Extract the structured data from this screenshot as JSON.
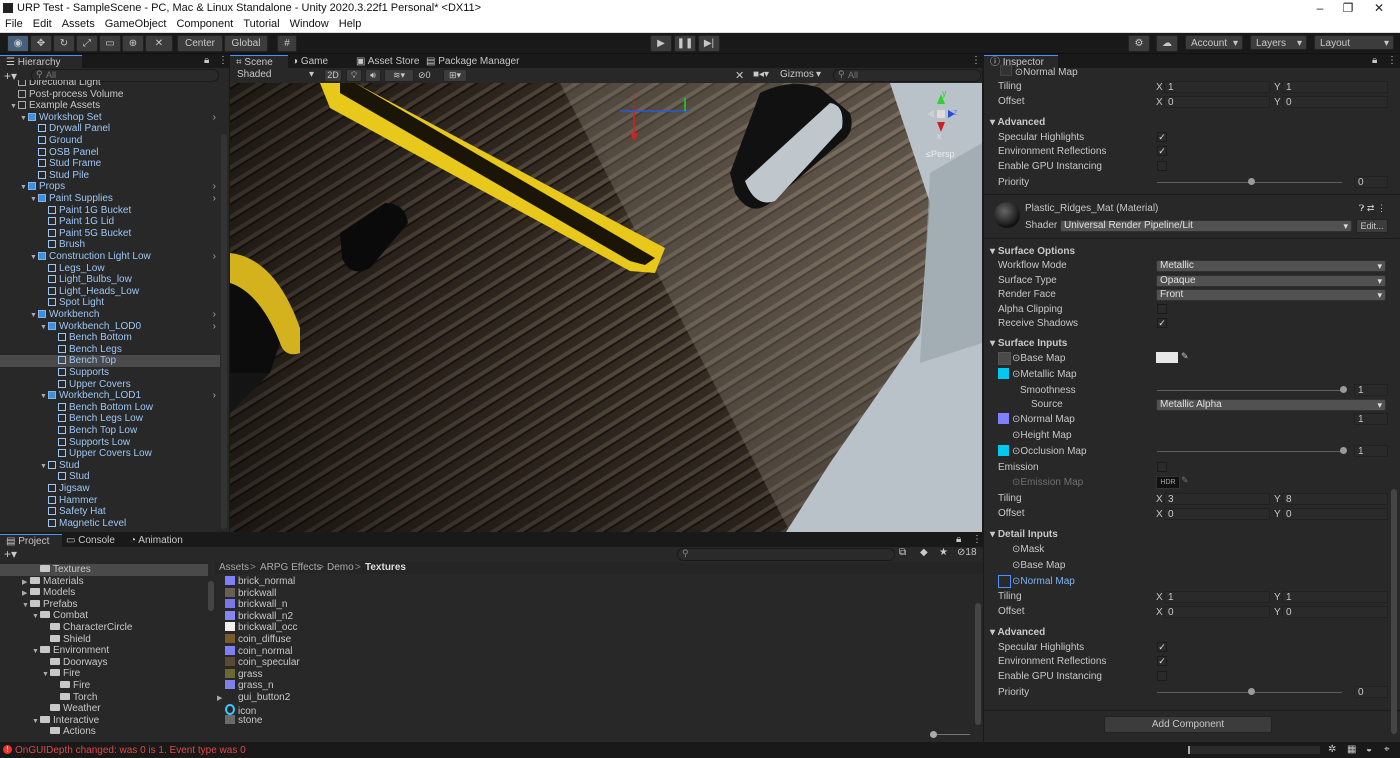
{
  "window": {
    "title": "URP Test - SampleScene - PC, Mac & Linux Standalone - Unity 2020.3.22f1 Personal* <DX11>"
  },
  "menu": [
    "File",
    "Edit",
    "Assets",
    "GameObject",
    "Component",
    "Tutorial",
    "Window",
    "Help"
  ],
  "toolbar": {
    "center": "Center",
    "global": "Global",
    "account": "Account",
    "layers": "Layers",
    "layout": "Layout"
  },
  "hierarchy": {
    "tab": "Hierarchy",
    "search_placeholder": "All",
    "items": [
      {
        "label": "Directional Light",
        "depth": 2,
        "arrow": false,
        "kind": "obj"
      },
      {
        "label": "Post-process Volume",
        "depth": 2,
        "arrow": false,
        "kind": "obj"
      },
      {
        "label": "Example Assets",
        "depth": 2,
        "arrow": true,
        "kind": "obj"
      },
      {
        "label": "Workshop Set",
        "depth": 3,
        "arrow": true,
        "kind": "prefab",
        "more": true
      },
      {
        "label": "Drywall Panel",
        "depth": 4,
        "arrow": false,
        "kind": "prefabchild"
      },
      {
        "label": "Ground",
        "depth": 4,
        "arrow": false,
        "kind": "prefabchild"
      },
      {
        "label": "OSB Panel",
        "depth": 4,
        "arrow": false,
        "kind": "prefabchild"
      },
      {
        "label": "Stud Frame",
        "depth": 4,
        "arrow": false,
        "kind": "prefabchild"
      },
      {
        "label": "Stud Pile",
        "depth": 4,
        "arrow": false,
        "kind": "prefabchild"
      },
      {
        "label": "Props",
        "depth": 3,
        "arrow": true,
        "kind": "prefab",
        "more": true
      },
      {
        "label": "Paint Supplies",
        "depth": 4,
        "arrow": true,
        "kind": "prefab",
        "more": true
      },
      {
        "label": "Paint 1G Bucket",
        "depth": 5,
        "arrow": false,
        "kind": "prefabchild"
      },
      {
        "label": "Paint 1G Lid",
        "depth": 5,
        "arrow": false,
        "kind": "prefabchild"
      },
      {
        "label": "Paint 5G Bucket",
        "depth": 5,
        "arrow": false,
        "kind": "prefabchild"
      },
      {
        "label": "Brush",
        "depth": 5,
        "arrow": false,
        "kind": "prefabchild"
      },
      {
        "label": "Construction Light Low",
        "depth": 4,
        "arrow": true,
        "kind": "prefab",
        "more": true
      },
      {
        "label": "Legs_Low",
        "depth": 5,
        "arrow": false,
        "kind": "prefabchild"
      },
      {
        "label": "Light_Bulbs_low",
        "depth": 5,
        "arrow": false,
        "kind": "prefabchild"
      },
      {
        "label": "Light_Heads_Low",
        "depth": 5,
        "arrow": false,
        "kind": "prefabchild"
      },
      {
        "label": "Spot Light",
        "depth": 5,
        "arrow": false,
        "kind": "prefabchild"
      },
      {
        "label": "Workbench",
        "depth": 4,
        "arrow": true,
        "kind": "prefab",
        "more": true
      },
      {
        "label": "Workbench_LOD0",
        "depth": 5,
        "arrow": true,
        "kind": "prefab",
        "more": true
      },
      {
        "label": "Bench Bottom",
        "depth": 6,
        "arrow": false,
        "kind": "prefabchild"
      },
      {
        "label": "Bench Legs",
        "depth": 6,
        "arrow": false,
        "kind": "prefabchild"
      },
      {
        "label": "Bench Top",
        "depth": 6,
        "arrow": false,
        "kind": "prefabchild",
        "selected": true
      },
      {
        "label": "Supports",
        "depth": 6,
        "arrow": false,
        "kind": "prefabchild"
      },
      {
        "label": "Upper Covers",
        "depth": 6,
        "arrow": false,
        "kind": "prefabchild"
      },
      {
        "label": "Workbench_LOD1",
        "depth": 5,
        "arrow": true,
        "kind": "prefab",
        "more": true
      },
      {
        "label": "Bench Bottom Low",
        "depth": 6,
        "arrow": false,
        "kind": "prefabchild"
      },
      {
        "label": "Bench Legs Low",
        "depth": 6,
        "arrow": false,
        "kind": "prefabchild"
      },
      {
        "label": "Bench Top Low",
        "depth": 6,
        "arrow": false,
        "kind": "prefabchild"
      },
      {
        "label": "Supports Low",
        "depth": 6,
        "arrow": false,
        "kind": "prefabchild"
      },
      {
        "label": "Upper Covers Low",
        "depth": 6,
        "arrow": false,
        "kind": "prefabchild"
      },
      {
        "label": "Stud",
        "depth": 5,
        "arrow": true,
        "kind": "prefabchild"
      },
      {
        "label": "Stud",
        "depth": 6,
        "arrow": false,
        "kind": "prefabchild"
      },
      {
        "label": "Jigsaw",
        "depth": 5,
        "arrow": false,
        "kind": "prefabchild"
      },
      {
        "label": "Hammer",
        "depth": 5,
        "arrow": false,
        "kind": "prefabchild"
      },
      {
        "label": "Safety Hat",
        "depth": 5,
        "arrow": false,
        "kind": "prefabchild"
      },
      {
        "label": "Magnetic Level",
        "depth": 5,
        "arrow": false,
        "kind": "prefabchild"
      }
    ]
  },
  "scene": {
    "tabs": [
      "Scene",
      "Game",
      "Asset Store",
      "Package Manager"
    ],
    "shading": "Shaded",
    "mode2d": "2D",
    "gizmos": "Gizmos",
    "search_placeholder": "All",
    "persp": "≤Persp",
    "fx_count": "0",
    "axis": {
      "x": "x",
      "y": "y",
      "z": "z"
    }
  },
  "project": {
    "tabs": [
      "Project",
      "Console",
      "Animation"
    ],
    "breadcrumb": [
      "Assets",
      "ARPG Effects",
      "Demo",
      "Textures"
    ],
    "hidden_count": "18",
    "tree": [
      {
        "label": "Textures",
        "depth": 3,
        "arrow": false,
        "selected": true
      },
      {
        "label": "Materials",
        "depth": 2,
        "arrow": true
      },
      {
        "label": "Models",
        "depth": 2,
        "arrow": true
      },
      {
        "label": "Prefabs",
        "depth": 2,
        "arrow": true,
        "open": true
      },
      {
        "label": "Combat",
        "depth": 3,
        "arrow": true,
        "open": true
      },
      {
        "label": "CharacterCircle",
        "depth": 4,
        "arrow": false
      },
      {
        "label": "Shield",
        "depth": 4,
        "arrow": false
      },
      {
        "label": "Environment",
        "depth": 3,
        "arrow": true,
        "open": true
      },
      {
        "label": "Doorways",
        "depth": 4,
        "arrow": false
      },
      {
        "label": "Fire",
        "depth": 4,
        "arrow": true,
        "open": true
      },
      {
        "label": "Fire",
        "depth": 5,
        "arrow": false
      },
      {
        "label": "Torch",
        "depth": 5,
        "arrow": false
      },
      {
        "label": "Weather",
        "depth": 4,
        "arrow": false
      },
      {
        "label": "Interactive",
        "depth": 3,
        "arrow": true,
        "open": true
      },
      {
        "label": "Actions",
        "depth": 4,
        "arrow": false
      }
    ],
    "assets": [
      {
        "label": "brick_normal",
        "color": "#8080ff"
      },
      {
        "label": "brickwall",
        "color": "#6a5f55"
      },
      {
        "label": "brickwall_n",
        "color": "#7a78e6"
      },
      {
        "label": "brickwall_n2",
        "color": "#8585f5"
      },
      {
        "label": "brickwall_occ",
        "color": "#f0f0f0"
      },
      {
        "label": "coin_diffuse",
        "color": "#7a5a2a"
      },
      {
        "label": "coin_normal",
        "color": "#7f7ff5"
      },
      {
        "label": "coin_specular",
        "color": "#5a4a35"
      },
      {
        "label": "grass",
        "color": "#6a6a30"
      },
      {
        "label": "grass_n",
        "color": "#8080e8"
      },
      {
        "label": "gui_button2",
        "color": "",
        "arrow": true
      },
      {
        "label": "icon",
        "color": "ring"
      },
      {
        "label": "stone",
        "color": "#6a6a6a"
      }
    ]
  },
  "inspector": {
    "tab": "Inspector",
    "top": {
      "normal_map": "Normal Map",
      "tiling": "Tiling",
      "tiling_x": "1",
      "tiling_y": "1",
      "offset": "Offset",
      "offset_x": "0",
      "offset_y": "0",
      "advanced": "Advanced",
      "specular": "Specular Highlights",
      "env_refl": "Environment Reflections",
      "gpu_inst": "Enable GPU Instancing",
      "priority": "Priority",
      "priority_val": "0"
    },
    "material": {
      "name": "Plastic_Ridges_Mat (Material)",
      "shader_label": "Shader",
      "shader": "Universal Render Pipeline/Lit",
      "edit": "Edit..."
    },
    "surface_options": {
      "header": "Surface Options",
      "workflow_label": "Workflow Mode",
      "workflow": "Metallic",
      "surface_label": "Surface Type",
      "surface": "Opaque",
      "render_face_label": "Render Face",
      "render_face": "Front",
      "alpha_clip": "Alpha Clipping",
      "receive_shadows": "Receive Shadows"
    },
    "surface_inputs": {
      "header": "Surface Inputs",
      "base_map": "Base Map",
      "metallic_map": "Metallic Map",
      "smoothness": "Smoothness",
      "smoothness_val": "1",
      "source_label": "Source",
      "source": "Metallic Alpha",
      "normal_map": "Normal Map",
      "normal_val": "1",
      "height_map": "Height Map",
      "occlusion_map": "Occlusion Map",
      "occlusion_val": "1",
      "emission": "Emission",
      "emission_map": "Emission Map",
      "hdr": "HDR",
      "tiling": "Tiling",
      "tiling_x": "3",
      "tiling_y": "8",
      "offset": "Offset",
      "offset_x": "0",
      "offset_y": "0"
    },
    "detail_inputs": {
      "header": "Detail Inputs",
      "mask": "Mask",
      "base_map": "Base Map",
      "normal_map": "Normal Map",
      "tiling": "Tiling",
      "tiling_x": "1",
      "tiling_y": "1",
      "offset": "Offset",
      "offset_x": "0",
      "offset_y": "0"
    },
    "advanced2": {
      "header": "Advanced",
      "specular": "Specular Highlights",
      "env_refl": "Environment Reflections",
      "gpu_inst": "Enable GPU Instancing",
      "priority": "Priority",
      "priority_val": "0"
    },
    "add_component": "Add Component",
    "x": "X",
    "y": "Y"
  },
  "status": {
    "message": "OnGUIDepth changed: was 0 is 1. Event type was 0"
  }
}
